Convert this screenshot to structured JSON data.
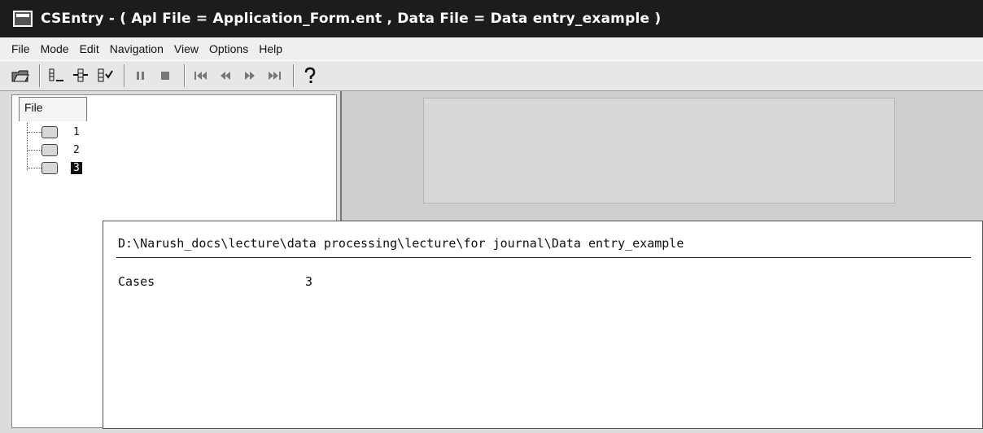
{
  "window": {
    "title": "CSEntry - ( Apl File = Application_Form.ent , Data File = Data entry_example )"
  },
  "menu": [
    "File",
    "Mode",
    "Edit",
    "Navigation",
    "View",
    "Options",
    "Help"
  ],
  "toolbar": {
    "buttons": [
      "open-icon",
      "insert-case-icon",
      "add-case-icon",
      "modify-case-icon",
      "pause-icon",
      "stop-icon",
      "first-case-icon",
      "previous-case-icon",
      "next-case-icon",
      "last-case-icon",
      "help-icon"
    ]
  },
  "tree": {
    "tab_label": "File",
    "cases": [
      {
        "label": "1",
        "selected": false
      },
      {
        "label": "2",
        "selected": false
      },
      {
        "label": "3",
        "selected": true
      }
    ]
  },
  "dialog": {
    "path": "D:\\Narush_docs\\lecture\\data processing\\lecture\\for journal\\Data entry_example",
    "cases_label": "Cases",
    "cases_value": "3"
  }
}
